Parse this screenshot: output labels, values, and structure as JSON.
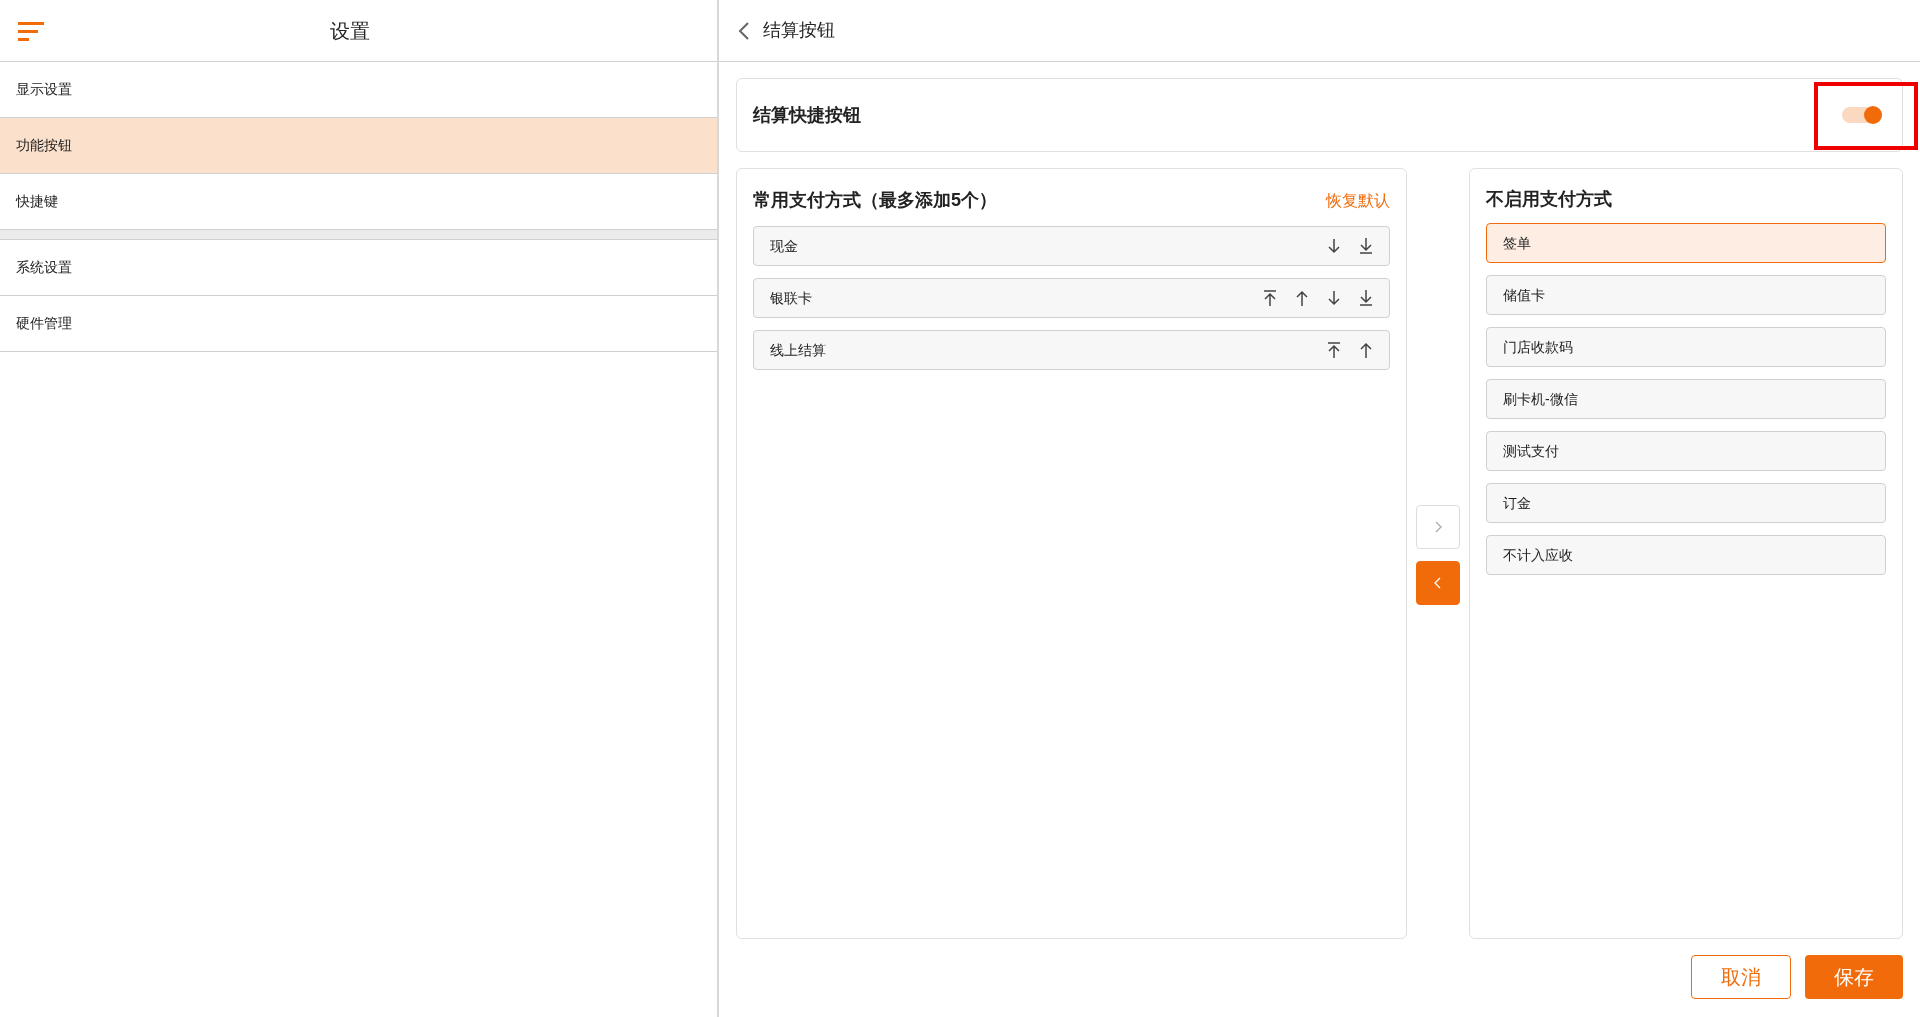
{
  "sidebar": {
    "title": "设置",
    "groups": [
      {
        "items": [
          {
            "label": "显示设置",
            "selected": false
          },
          {
            "label": "功能按钮",
            "selected": true
          },
          {
            "label": "快捷键",
            "selected": false
          }
        ]
      },
      {
        "items": [
          {
            "label": "系统设置",
            "selected": false
          },
          {
            "label": "硬件管理",
            "selected": false
          }
        ]
      }
    ]
  },
  "page": {
    "title": "结算按钮"
  },
  "shortcut": {
    "label": "结算快捷按钮",
    "on": true,
    "highlighted": true
  },
  "common": {
    "title": "常用支付方式（最多添加5个）",
    "reset": "恢复默认",
    "items": [
      {
        "label": "现金",
        "actions": [
          {
            "kind": "down"
          },
          {
            "kind": "bottom"
          }
        ]
      },
      {
        "label": "银联卡",
        "actions": [
          {
            "kind": "top"
          },
          {
            "kind": "up"
          },
          {
            "kind": "down"
          },
          {
            "kind": "bottom"
          }
        ]
      },
      {
        "label": "线上结算",
        "actions": [
          {
            "kind": "top"
          },
          {
            "kind": "up"
          }
        ]
      }
    ]
  },
  "transfer": {
    "right_enabled": false,
    "left_enabled": true
  },
  "disabled": {
    "title": "不启用支付方式",
    "items": [
      {
        "label": "签单",
        "selected": true
      },
      {
        "label": "储值卡",
        "selected": false
      },
      {
        "label": "门店收款码",
        "selected": false
      },
      {
        "label": "刷卡机-微信",
        "selected": false
      },
      {
        "label": "测试支付",
        "selected": false
      },
      {
        "label": "订金",
        "selected": false
      },
      {
        "label": "不计入应收",
        "selected": false
      }
    ]
  },
  "buttons": {
    "cancel": "取消",
    "save": "保存"
  }
}
